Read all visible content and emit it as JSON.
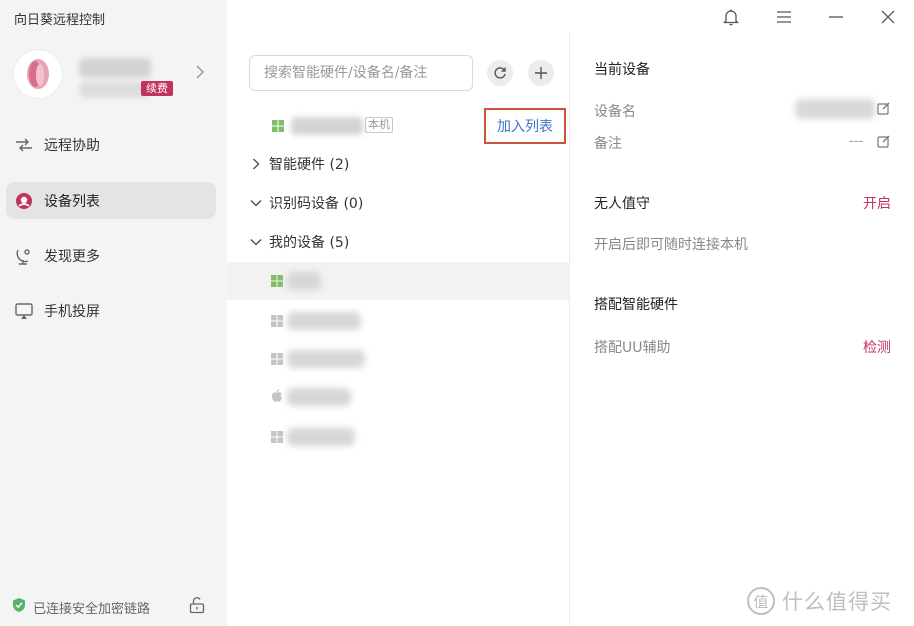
{
  "app": {
    "title": "向日葵远程控制"
  },
  "profile": {
    "renew_badge": "续费"
  },
  "sidebar": {
    "items": [
      {
        "label": "远程协助",
        "icon": "remote-assist-icon"
      },
      {
        "label": "设备列表",
        "icon": "device-list-icon",
        "active": true
      },
      {
        "label": "发现更多",
        "icon": "discover-icon"
      },
      {
        "label": "手机投屏",
        "icon": "screen-cast-icon"
      }
    ]
  },
  "status": {
    "security_text": "已连接安全加密链路"
  },
  "search": {
    "placeholder": "搜索智能硬件/设备名/备注"
  },
  "local_device": {
    "tag": "本机",
    "add_button": "加入列表"
  },
  "groups": [
    {
      "label": "智能硬件 (2)",
      "expanded": false
    },
    {
      "label": "识别码设备 (0)",
      "expanded": true
    },
    {
      "label": "我的设备 (5)",
      "expanded": true
    }
  ],
  "devices": [
    {
      "os": "windows",
      "selected": true
    },
    {
      "os": "windows"
    },
    {
      "os": "windows"
    },
    {
      "os": "apple"
    },
    {
      "os": "windows"
    }
  ],
  "details": {
    "current_device": {
      "title": "当前设备",
      "name_label": "设备名",
      "note_label": "备注",
      "note_value": "---"
    },
    "unattended": {
      "title": "无人值守",
      "action": "开启",
      "description": "开启后即可随时连接本机"
    },
    "smart_hardware": {
      "title": "搭配智能硬件",
      "uu_label": "搭配UU辅助",
      "action": "检测"
    }
  },
  "watermark": {
    "text": "什么值得买",
    "logo": "值"
  },
  "colors": {
    "brand": "#c2325a",
    "link_blue": "#3f74c6",
    "highlight_box": "#c9543d",
    "sidebar_bg": "#f4f4f5",
    "windows_icon": "#7fbf6a"
  }
}
